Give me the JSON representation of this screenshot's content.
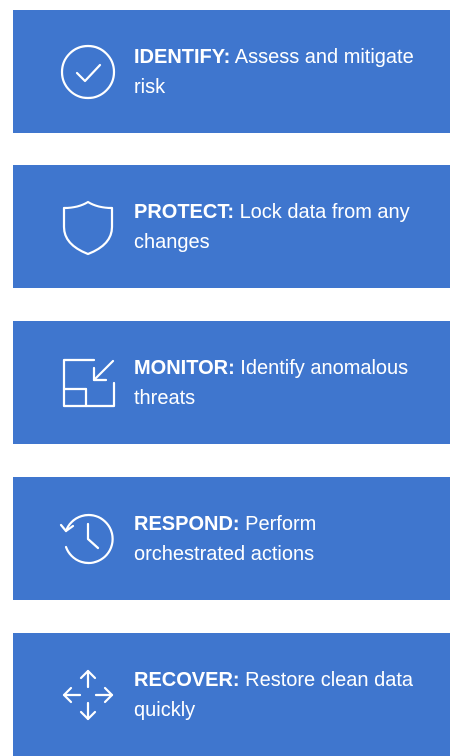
{
  "colors": {
    "card_bg": "#3f76ce",
    "text": "#ffffff",
    "page_bg": "#ffffff"
  },
  "cards": [
    {
      "heading": "IDENTIFY:",
      "description": "Assess and mitigate risk",
      "icon": "check-circle-icon"
    },
    {
      "heading": "PROTECT:",
      "description": "Lock data from any changes",
      "icon": "shield-icon"
    },
    {
      "heading": "MONITOR:",
      "description": "Identify anomalous threats",
      "icon": "monitor-window-icon"
    },
    {
      "heading": "RESPOND:",
      "description": "Perform orchestrated actions",
      "icon": "history-clock-icon"
    },
    {
      "heading": "RECOVER:",
      "description": "Restore clean data quickly",
      "icon": "move-arrows-icon"
    }
  ]
}
